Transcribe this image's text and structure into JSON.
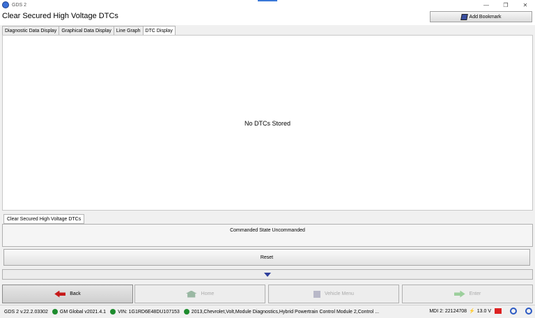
{
  "window": {
    "title": "GDS 2",
    "controls": {
      "minimize": "—",
      "restore": "❐",
      "close": "✕"
    }
  },
  "header": {
    "title": "Clear Secured High Voltage DTCs",
    "bookmark_label": "Add Bookmark"
  },
  "tabs": [
    {
      "label": "Diagnostic Data Display",
      "active": false
    },
    {
      "label": "Graphical Data Display",
      "active": false
    },
    {
      "label": "Line Graph",
      "active": false
    },
    {
      "label": "DTC Display",
      "active": true
    }
  ],
  "content": {
    "empty_message": "No DTCs Stored"
  },
  "control_panel": {
    "tab_label": "Clear Secured High Voltage DTCs",
    "state_text": "Commanded State  Uncommanded",
    "reset_label": "Reset"
  },
  "nav": {
    "back": "Back",
    "home": "Home",
    "vehicle_menu": "Vehicle Menu",
    "enter": "Enter"
  },
  "status": {
    "version": "GDS 2 v.22.2.03302",
    "gm_global": "GM Global v2021.4.1",
    "vin": "VIN: 1G1RD6E48DU107153",
    "vehicle": "2013,Chevrolet,Volt,Module Diagnostics,Hybrid Powertrain Control Module 2,Control ...",
    "mdi": "MDI 2: 22124708",
    "voltage": "13.0 V"
  },
  "colors": {
    "accent": "#2e3f9c",
    "status_ok": "#1e8c2e",
    "back_arrow": "#c61a1a"
  }
}
